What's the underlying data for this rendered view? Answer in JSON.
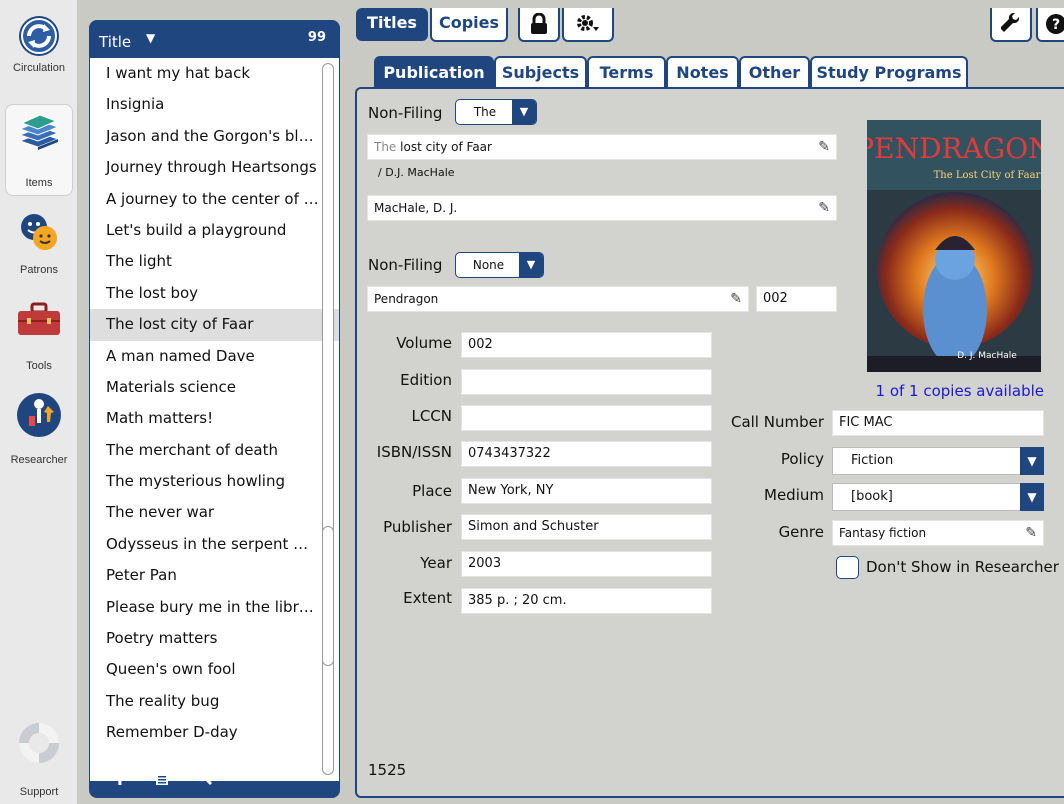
{
  "nav": {
    "items": [
      {
        "label": "Circulation",
        "icon": "circulation-icon"
      },
      {
        "label": "Items",
        "icon": "books-icon"
      },
      {
        "label": "Patrons",
        "icon": "patrons-icon"
      },
      {
        "label": "Tools",
        "icon": "toolbox-icon"
      },
      {
        "label": "Researcher",
        "icon": "researcher-icon"
      },
      {
        "label": "Support",
        "icon": "lifebuoy-icon"
      }
    ]
  },
  "list": {
    "header_label": "Title",
    "sort_icon": "▼",
    "count": "99",
    "rows": [
      "I want my hat back",
      "Insignia",
      "Jason and the Gorgon's blood",
      "Journey through Heartsongs",
      "A journey to the center of th...",
      "Let's build a playground",
      "The light",
      "The lost boy",
      "The lost city of Faar",
      "A man named Dave",
      "Materials science",
      "Math matters!",
      "The merchant of death",
      "The mysterious howling",
      "The never war",
      "Odysseus in the serpent maze",
      "Peter Pan",
      "Please bury me in the library",
      "Poetry matters",
      "Queen's own fool",
      "The reality bug",
      "Remember D-day"
    ],
    "selected_index": 8
  },
  "top_tabs": {
    "titles": "Titles",
    "copies": "Copies"
  },
  "sub_tabs": [
    "Publication",
    "Subjects",
    "Terms",
    "Notes",
    "Other",
    "Study Programs"
  ],
  "publication": {
    "nonfiling1_label": "Non-Filing",
    "nonfiling1_value": "The",
    "title_prefix": "The",
    "title_rest": " lost city of Faar",
    "statement": "/ D.J. MacHale",
    "author": "MacHale, D. J.",
    "nonfiling2_label": "Non-Filing",
    "nonfiling2_value": "None",
    "series": "Pendragon",
    "series_number": "002",
    "fields": [
      {
        "label": "Volume",
        "value": "002"
      },
      {
        "label": "Edition",
        "value": ""
      },
      {
        "label": "LCCN",
        "value": ""
      },
      {
        "label": "ISBN/ISSN",
        "value": "0743437322"
      },
      {
        "label": "Place",
        "value": "New York, NY"
      },
      {
        "label": "Publisher",
        "value": "Simon and Schuster"
      },
      {
        "label": "Year",
        "value": "2003"
      },
      {
        "label": "Extent",
        "value": "385 p. ; 20 cm."
      }
    ],
    "availability": "1 of 1 copies available",
    "call_number_label": "Call Number",
    "call_number": "FIC MAC",
    "policy_label": "Policy",
    "policy": "Fiction",
    "medium_label": "Medium",
    "medium": "[book]",
    "genre_label": "Genre",
    "genre": "Fantasy fiction",
    "dont_show_label": "Don't Show in Researcher",
    "record_id": "1525"
  },
  "cover": {
    "title": "PENDRAGON",
    "subtitle": "The Lost City of Faar",
    "author": "D. J. MacHale"
  },
  "colors": {
    "accent": "#1f467f",
    "panel": "#d2d3cf",
    "link": "#1a1acb"
  }
}
